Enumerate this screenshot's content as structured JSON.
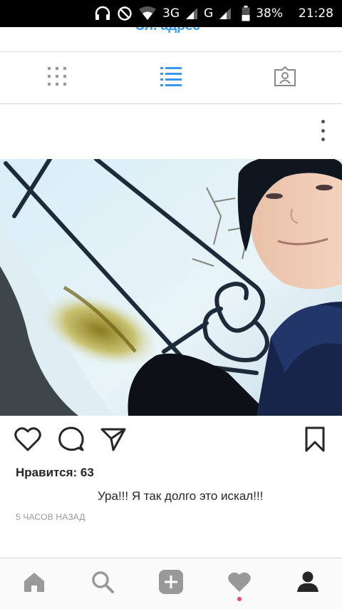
{
  "status_bar": {
    "network_3g": "3G",
    "network_g": "G",
    "battery": "38%",
    "time": "21:28",
    "icons": [
      "headphones-icon",
      "do-not-disturb-icon",
      "wifi-icon",
      "signal-icon",
      "signal-icon",
      "battery-icon"
    ]
  },
  "profile": {
    "email_label": "Эл. адрес"
  },
  "view_tabs": [
    "grid-view-icon",
    "list-view-icon",
    "tagged-photos-icon"
  ],
  "post": {
    "likes": "Нравится: 63",
    "caption": "Ура!!! Я так долго это искал!!!",
    "time_ago": "5 ЧАСОВ НАЗАД"
  },
  "bottom_nav": [
    "home-icon",
    "search-icon",
    "add-post-icon",
    "activity-heart-icon",
    "profile-icon"
  ],
  "colors": {
    "accent": "#3897f0",
    "icon_gray": "#999999",
    "notification": "#ed4956"
  }
}
